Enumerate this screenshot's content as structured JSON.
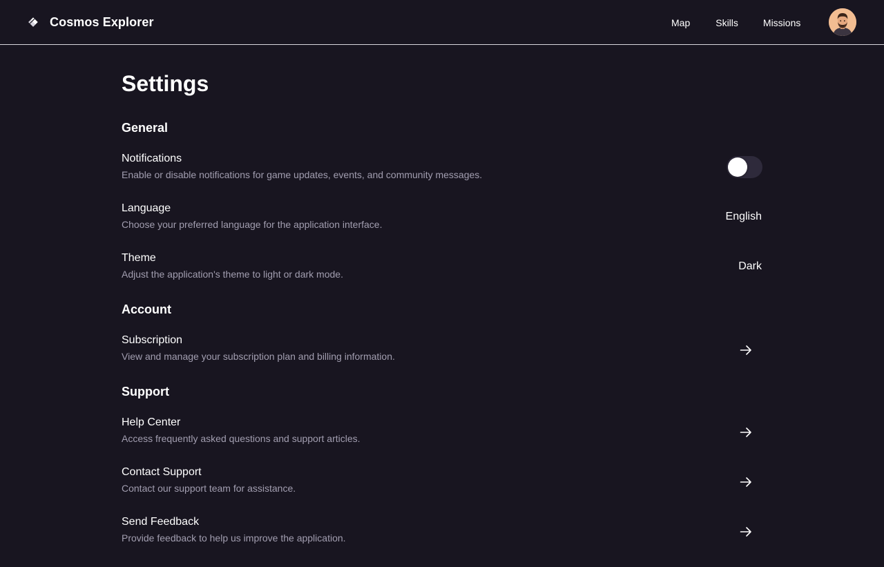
{
  "app": {
    "name": "Cosmos Explorer",
    "logo_icon": "diamond-logo-icon"
  },
  "nav": {
    "items": [
      {
        "label": "Map"
      },
      {
        "label": "Skills"
      },
      {
        "label": "Missions"
      }
    ],
    "avatar_icon": "user-avatar"
  },
  "page": {
    "title": "Settings"
  },
  "sections": {
    "general": {
      "title": "General",
      "notifications": {
        "label": "Notifications",
        "description": "Enable or disable notifications for game updates, events, and community messages.",
        "enabled": false
      },
      "language": {
        "label": "Language",
        "description": "Choose your preferred language for the application interface.",
        "value": "English"
      },
      "theme": {
        "label": "Theme",
        "description": "Adjust the application's theme to light or dark mode.",
        "value": "Dark"
      }
    },
    "account": {
      "title": "Account",
      "subscription": {
        "label": "Subscription",
        "description": "View and manage your subscription plan and billing information."
      }
    },
    "support": {
      "title": "Support",
      "help_center": {
        "label": "Help Center",
        "description": "Access frequently asked questions and support articles."
      },
      "contact_support": {
        "label": "Contact Support",
        "description": "Contact our support team for assistance."
      },
      "send_feedback": {
        "label": "Send Feedback",
        "description": "Provide feedback to help us improve the application."
      }
    }
  },
  "colors": {
    "background": "#181520",
    "text_primary": "#ffffff",
    "text_secondary": "#a29eb0",
    "toggle_track": "#2e2a3b",
    "divider": "#d9d7df"
  },
  "icons": {
    "row_action": "arrow-right-icon"
  }
}
